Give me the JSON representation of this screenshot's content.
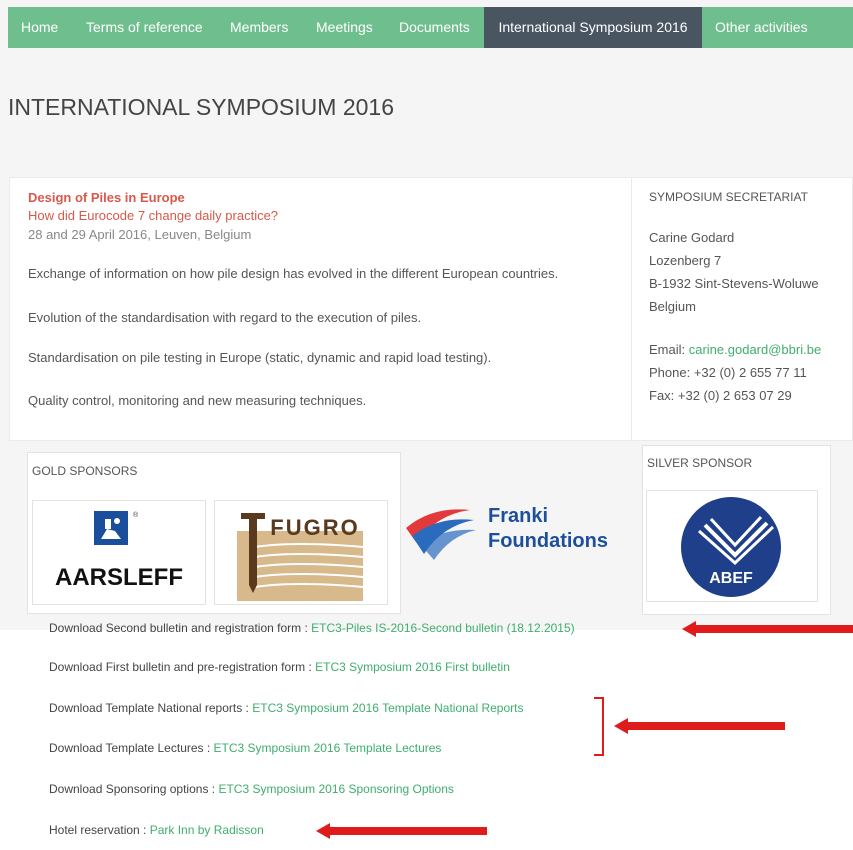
{
  "nav": {
    "items": [
      "Home",
      "Terms of reference",
      "Members",
      "Meetings",
      "Documents",
      "International Symposium 2016",
      "Other activities"
    ],
    "active_index": 5,
    "bg_color": "#6fbf8e",
    "active_color": "#4a5562"
  },
  "page_title": "INTERNATIONAL SYMPOSIUM 2016",
  "event": {
    "title": "Design of Piles in Europe",
    "subtitle": "How did Eurocode 7 change daily practice?",
    "date_location": "28 and 29 April 2016, Leuven, Belgium",
    "topics": [
      "Exchange of information on how pile design has evolved in the different European countries.",
      "Evolution of the standardisation with regard to the execution of piles.",
      "Standardisation on pile testing in Europe (static, dynamic and rapid load testing).",
      "Quality control, monitoring and new measuring techniques."
    ]
  },
  "secretariat": {
    "heading": "SYMPOSIUM SECRETARIAT",
    "name": "Carine Godard",
    "street": "Lozenberg 7",
    "city": "B-1932 Sint-Stevens-Woluwe",
    "country": "Belgium",
    "email_label": "Email: ",
    "email": "carine.godard@bbri.be",
    "phone": "Phone: +32 (0) 2 655 77 11",
    "fax": "Fax: +32 (0) 2 653 07 29"
  },
  "sponsors": {
    "gold_label": "GOLD SPONSORS",
    "silver_label": "SILVER SPONSOR",
    "gold": [
      "AARSLEFF",
      "FUGRO",
      "Franki Foundations"
    ],
    "franki_line1": "Franki",
    "franki_line2": "Foundations",
    "silver": [
      "ABEF"
    ]
  },
  "downloads": [
    {
      "label": "Download Second bulletin and registration form : ",
      "link": "ETC3-Piles IS-2016-Second bulletin (18.12.2015)"
    },
    {
      "label": "Download First bulletin and pre-registration form : ",
      "link": "ETC3 Symposium 2016 First bulletin"
    },
    {
      "label": "Download Template National reports : ",
      "link": "ETC3 Symposium 2016 Template National Reports"
    },
    {
      "label": "Download Template Lectures : ",
      "link": "ETC3 Symposium 2016 Template Lectures"
    },
    {
      "label": "Download Sponsoring options : ",
      "link": "ETC3 Symposium 2016 Sponsoring Options"
    },
    {
      "label": "Hotel reservation : ",
      "link": "Park Inn by Radisson"
    }
  ],
  "colors": {
    "accent_red": "#d9584b",
    "link_green": "#3fae6d",
    "arrow_red": "#e01b1b"
  }
}
